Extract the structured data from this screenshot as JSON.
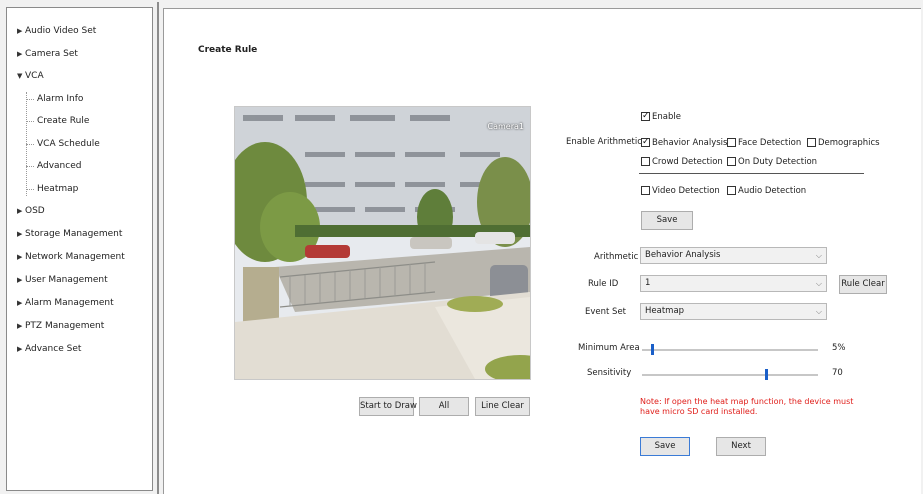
{
  "sidebar": {
    "items": [
      {
        "label": "Audio Video Set",
        "caret": "▶"
      },
      {
        "label": "Camera Set",
        "caret": "▶"
      },
      {
        "label": "VCA",
        "caret": "▼"
      },
      {
        "label": "OSD",
        "caret": "▶"
      },
      {
        "label": "Storage Management",
        "caret": "▶"
      },
      {
        "label": "Network Management",
        "caret": "▶"
      },
      {
        "label": "User Management",
        "caret": "▶"
      },
      {
        "label": "Alarm Management",
        "caret": "▶"
      },
      {
        "label": "PTZ Management",
        "caret": "▶"
      },
      {
        "label": "Advance Set",
        "caret": "▶"
      }
    ],
    "vca_sub": [
      "Alarm Info",
      "Create Rule",
      "VCA Schedule",
      "Advanced",
      "Heatmap"
    ]
  },
  "main": {
    "title": "Create Rule",
    "video": {
      "camera_label": "Camera1"
    },
    "draw_buttons": {
      "start": "Start to Draw",
      "all": "All",
      "clear": "Line Clear"
    },
    "enable_label": "Enable",
    "enable_checked": true,
    "arithmetic_label": "Enable Arithmetic",
    "options": {
      "behavior": {
        "label": "Behavior Analysis",
        "checked": true
      },
      "face": {
        "label": "Face Detection",
        "checked": false
      },
      "demographics": {
        "label": "Demographics",
        "checked": false
      },
      "crowd": {
        "label": "Crowd Detection",
        "checked": false
      },
      "duty": {
        "label": "On Duty Detection",
        "checked": false
      },
      "video": {
        "label": "Video Detection",
        "checked": false
      },
      "audio": {
        "label": "Audio Detection",
        "checked": false
      }
    },
    "save_top": "Save",
    "form": {
      "arithmetic": {
        "label": "Arithmetic",
        "value": "Behavior Analysis"
      },
      "rule_id": {
        "label": "Rule ID",
        "value": "1"
      },
      "rule_clear": "Rule Clear",
      "event_set": {
        "label": "Event Set",
        "value": "Heatmap"
      },
      "min_area": {
        "label": "Minimum Area",
        "value": "5%",
        "level": 0.05
      },
      "sensitivity": {
        "label": "Sensitivity",
        "value": "70",
        "level": 0.7
      }
    },
    "note": "Note: If open the heat map function, the device must have micro SD card installed.",
    "save_bottom": "Save",
    "next": "Next"
  },
  "colors": {
    "accent": "#1a5fc8",
    "note": "#e0201c"
  }
}
